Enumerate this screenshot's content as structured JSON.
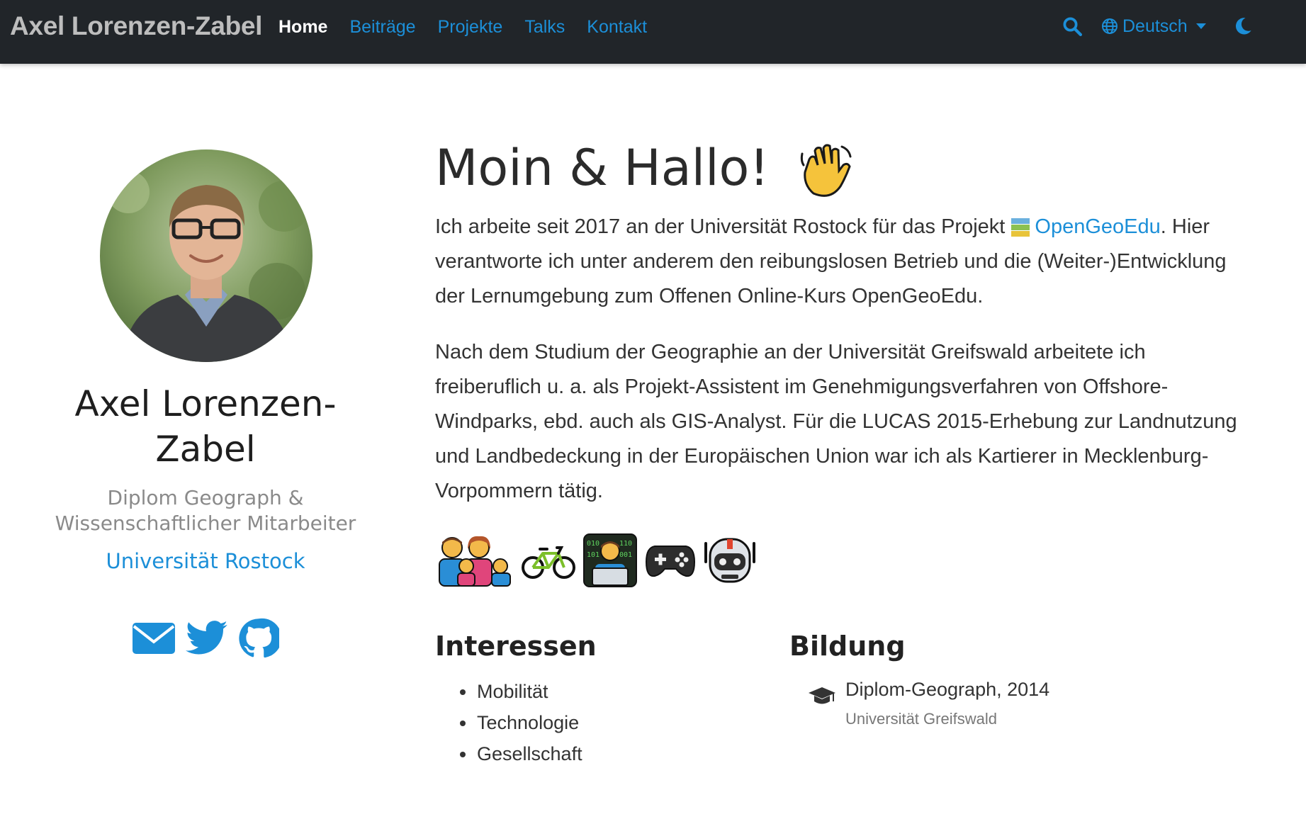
{
  "navbar": {
    "brand": "Axel Lorenzen-Zabel",
    "links": [
      {
        "label": "Home",
        "active": true
      },
      {
        "label": "Beiträge",
        "active": false
      },
      {
        "label": "Projekte",
        "active": false
      },
      {
        "label": "Talks",
        "active": false
      },
      {
        "label": "Kontakt",
        "active": false
      }
    ],
    "language": "Deutsch",
    "icons": [
      "search-icon",
      "globe-icon",
      "moon-icon"
    ]
  },
  "profile": {
    "name": "Axel Lorenzen-Zabel",
    "role": "Diplom Geograph & Wissenschaftlicher Mitarbeiter",
    "organization": "Universität Rostock",
    "social_icons": [
      "envelope-icon",
      "twitter-icon",
      "github-icon"
    ]
  },
  "intro": {
    "heading": "Moin & Hallo!",
    "p1_before": "Ich arbeite seit 2017 an der Universität Rostock für das Projekt ",
    "p1_link": "OpenGeoEdu",
    "p1_after": ". Hier verantworte ich unter anderem den reibungslosen Betrieb und die (Weiter-)Entwicklung der Lernumgebung zum Offenen Online-Kurs OpenGeoEdu.",
    "p2": "Nach dem Studium der Geographie an der Universität Greifswald arbeitete ich freiberuflich u. a. als Projekt-Assistent im Genehmigungsverfahren von Offshore-Windparks, ebd. auch als GIS-Analyst. Für die LUCAS 2015-Erhebung zur Landnutzung und Landbedeckung in der Europäischen Union war ich als Kartierer in Mecklenburg-Vorpommern tätig.",
    "emoji_icons": [
      "family-icon",
      "bicycle-icon",
      "technologist-icon",
      "gamepad-icon",
      "robot-icon"
    ]
  },
  "interests": {
    "title": "Interessen",
    "items": [
      "Mobilität",
      "Technologie",
      "Gesellschaft"
    ]
  },
  "education": {
    "title": "Bildung",
    "items": [
      {
        "degree": "Diplom-Geograph, 2014",
        "institution": "Universität Greifswald"
      }
    ]
  },
  "colors": {
    "navbar_bg": "#212529",
    "link": "#1c8fd8",
    "text": "#333333"
  }
}
